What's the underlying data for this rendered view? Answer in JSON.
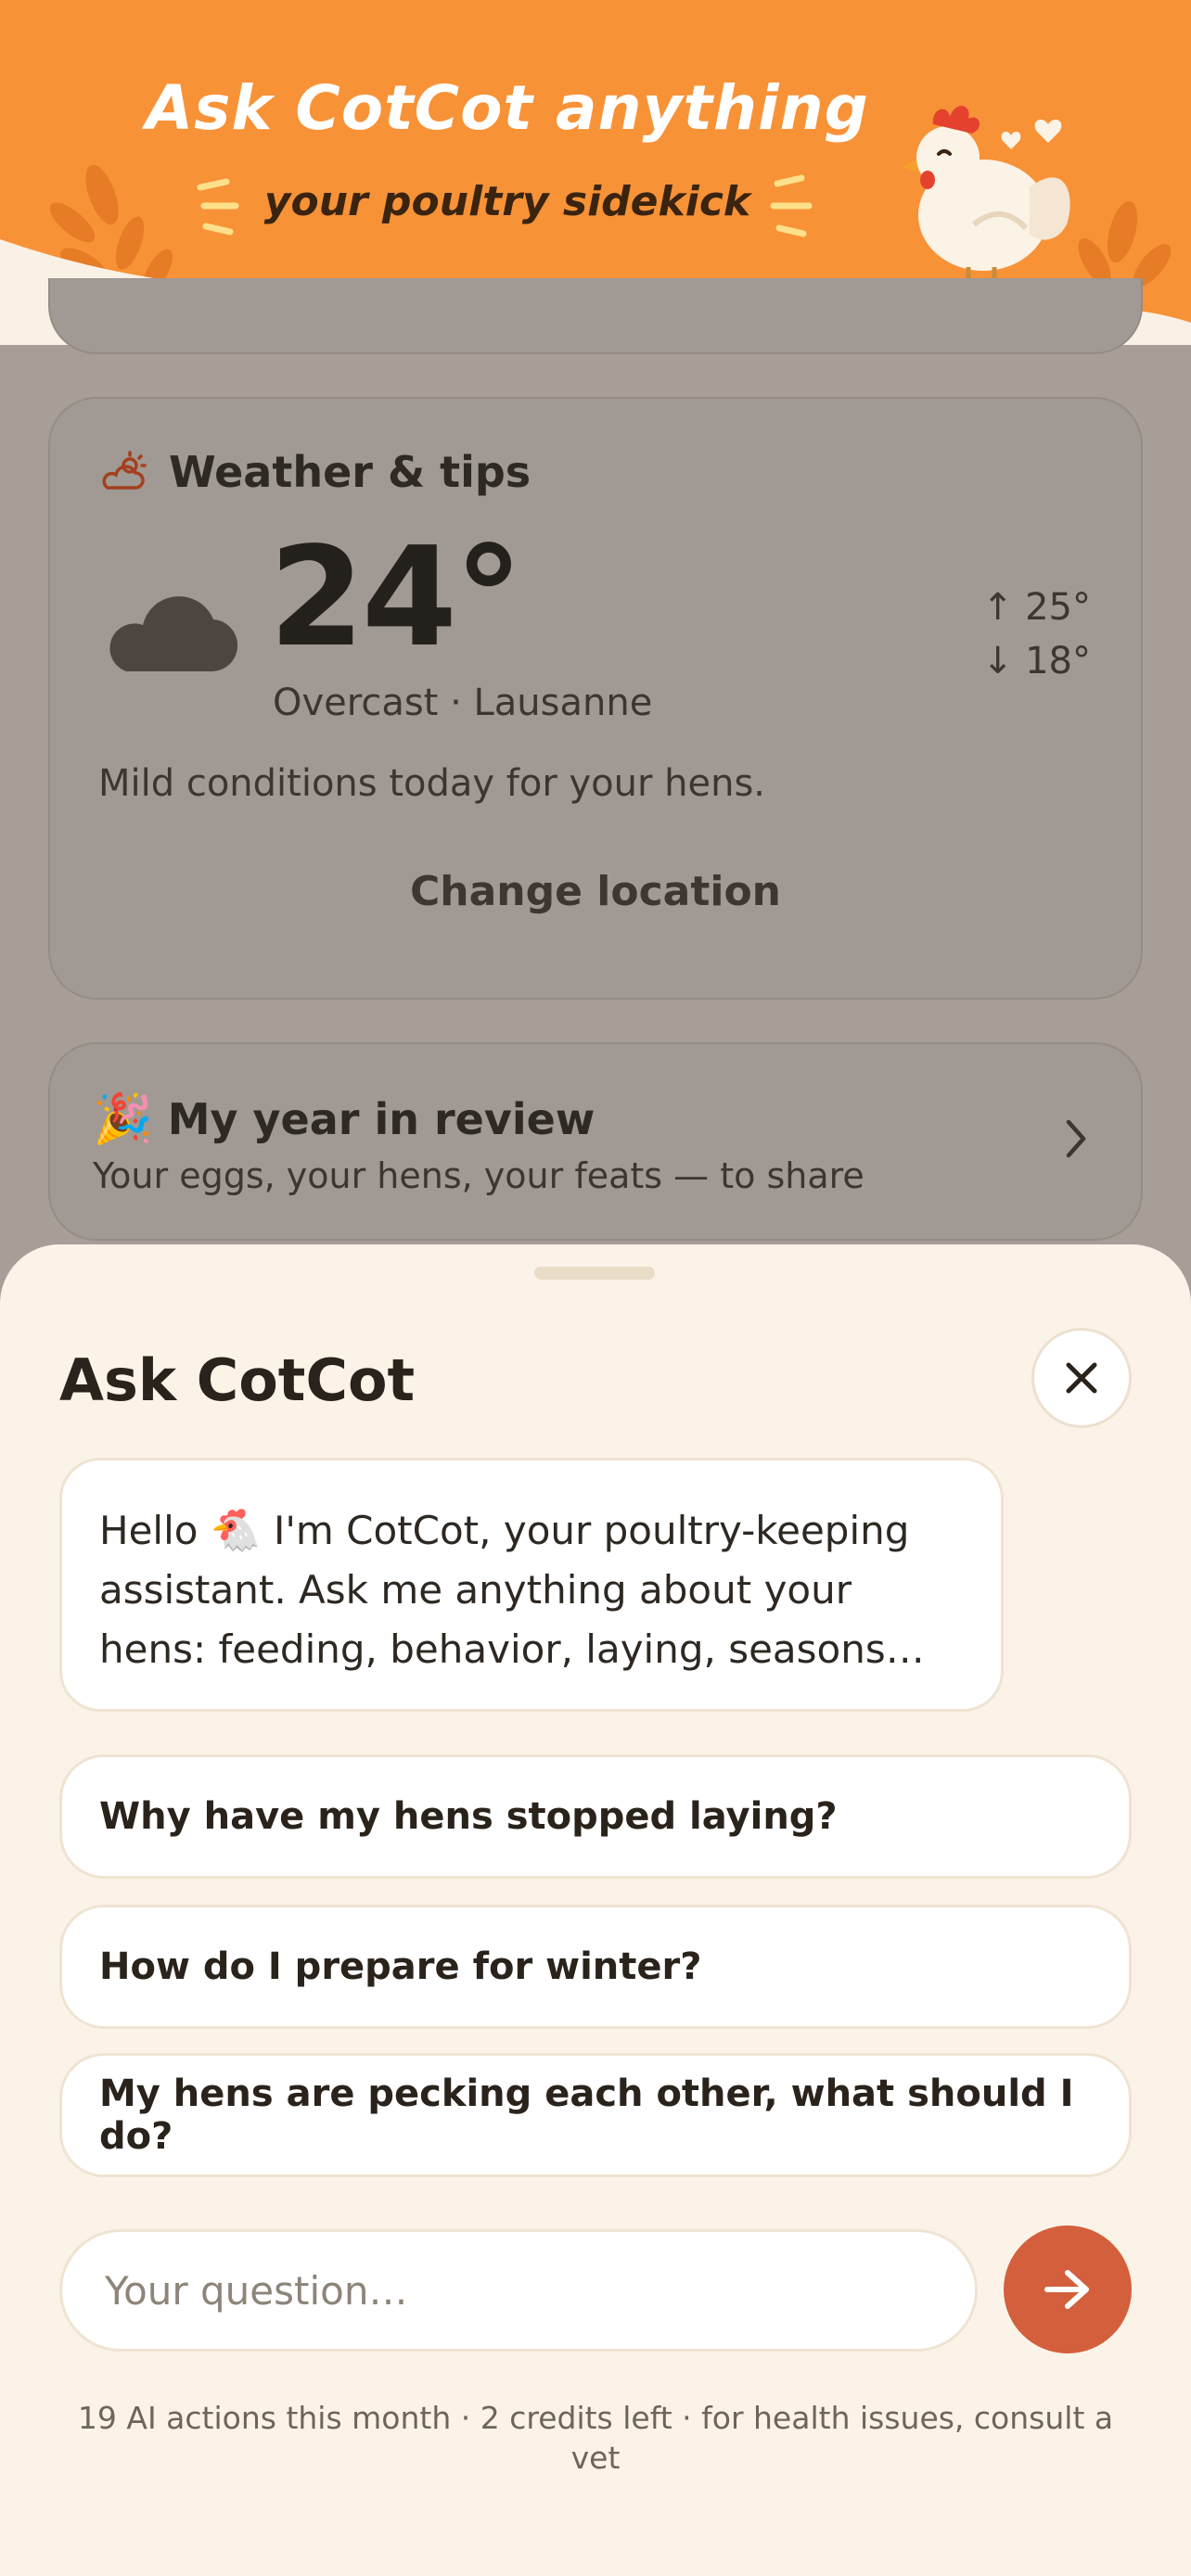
{
  "banner": {
    "title": "Ask CotCot anything",
    "subtitle": "your poultry sidekick"
  },
  "weather": {
    "title": "Weather & tips",
    "icon": "partly-cloudy-icon",
    "condition_icon": "cloud-icon",
    "temperature": "24°",
    "condition": "Overcast · Lausanne",
    "high": "↑ 25°",
    "low": "↓ 18°",
    "tip": "Mild conditions today for your hens.",
    "change_location": "Change location"
  },
  "year_review": {
    "emoji": "🎉",
    "title": "My year in review",
    "subtitle": "Your eggs, your hens, your feats — to share"
  },
  "sheet": {
    "title": "Ask CotCot",
    "greeting_before": "Hello ",
    "greeting_emoji": "🐔",
    "greeting_after": " I'm CotCot, your poultry-keeping assistant. Ask me anything about your hens: feeding, behavior, laying, seasons…",
    "suggestions": [
      "Why have my hens stopped laying?",
      "How do I prepare for winter?",
      "My hens are pecking each other, what should I do?"
    ],
    "input_placeholder": "Your question…",
    "footnote": "19 AI actions this month · 2 credits left · for health issues, consult a vet"
  },
  "colors": {
    "banner": "#f89237",
    "accent": "#d45f3c",
    "sheet_bg": "#fbf3e8",
    "overlay": "#a69e97"
  }
}
